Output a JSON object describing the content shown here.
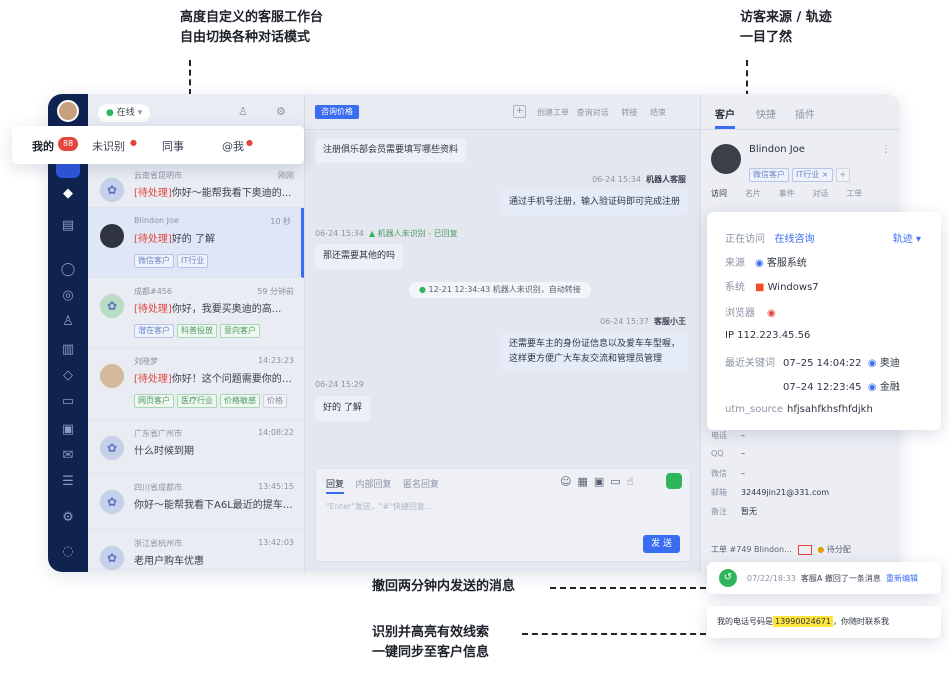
{
  "annotations": {
    "top_left": [
      "高度自定义的客服工作台",
      "自由切换各种对话模式"
    ],
    "top_right": [
      "访客来源 / 轨迹",
      "一目了然"
    ],
    "recall": "撤回两分钟内发送的消息",
    "highlight": [
      "识别并高亮有效线索",
      "一键同步至客户信息"
    ]
  },
  "header": {
    "status": "在线",
    "consult_tab": "咨询价格",
    "actions": [
      "创建工单",
      "查询对话",
      "转接",
      "结束"
    ],
    "right_tabs": [
      "客户",
      "快捷",
      "插件"
    ]
  },
  "list_tabs": {
    "mine": "我的",
    "mine_count": "88",
    "unknown": "未识别",
    "peer": "同事",
    "at": "@我"
  },
  "conversations": [
    {
      "loc": "云南省昆明市",
      "time": "刚刚",
      "status": "[待处理]",
      "msg": "你好～能帮我看下奥迪的...",
      "tags": []
    },
    {
      "name": "Blindon Joe",
      "time": "10 秒",
      "status": "[待处理]",
      "msg": "好的 了解",
      "tags": [
        "微信客户",
        "IT行业"
      ]
    },
    {
      "loc": "成都#456",
      "time": "59 分钟前",
      "status": "[待处理]",
      "msg": "你好，我要买奥迪的高...",
      "tags": [
        "潜在客户",
        "科普投放",
        "意向客户"
      ]
    },
    {
      "name": "刘晓梦",
      "time": "14:23:23",
      "status": "[待处理]",
      "msg": "你好！这个问题需要你的帮...",
      "tags": [
        "网页客户",
        "医疗行业",
        "价格敏感",
        "价格"
      ]
    },
    {
      "loc": "广东省广州市",
      "time": "14:08:22",
      "msg": "什么时候到期",
      "tags": []
    },
    {
      "loc": "四川省成都市",
      "time": "13:45:15",
      "msg": "你好～能帮我看下A6L最近的提车日吗",
      "tags": []
    },
    {
      "loc": "浙江省杭州市",
      "time": "13:42:03",
      "msg": "老用户购车优惠",
      "tags": []
    }
  ],
  "chat": {
    "m1": "注册俱乐部会员需要填写哪些资料",
    "m2_meta": "06-24 15:34",
    "m2_sender": "机器人客服",
    "m2": "通过手机号注册，输入验证码即可完成注册",
    "m3_meta": "06-24 15:34",
    "m3_flag": "机器人未识别 - 已回复",
    "m3": "那还需要其他的吗",
    "system": "12-21 12:34:43  机器人未识别，自动转接",
    "m4_meta": "06-24 15:37",
    "m4_sender": "客服小王",
    "m4": [
      "还需要车主的身份证信息以及爱车车型喔，",
      "这样更方便广大车友交流和管理员管理"
    ],
    "m5_meta": "06-24 15:29",
    "m5": "好的 了解",
    "composer_tabs": [
      "回复",
      "内部回复",
      "匿名回复"
    ],
    "composer_placeholder": "\"Enter\"发送，\"#\"快捷回复...",
    "send": "发 送"
  },
  "customer": {
    "name": "Blindon Joe",
    "tags": [
      "微信客户",
      "IT行业 ×"
    ],
    "subtabs": [
      "访问",
      "名片",
      "事件",
      "对话",
      "工单"
    ],
    "fields": [
      {
        "k": "电话",
        "v": "–"
      },
      {
        "k": "QQ",
        "v": "–"
      },
      {
        "k": "微信",
        "v": "–"
      },
      {
        "k": "邮箱",
        "v": "32449jin21@331.com"
      },
      {
        "k": "备注",
        "v": "暂无"
      }
    ],
    "ticket": "工单 #749   Blindon...",
    "ticket_status": "待分配"
  },
  "visit": {
    "label": "正在访问",
    "value": "在线咨询",
    "track": "轨迹",
    "source_k": "来源",
    "source_v": "客服系统",
    "os_k": "系统",
    "os_v": "Windows7",
    "browser_k": "浏览器",
    "ip": "IP   112.223.45.56",
    "kw_k": "最近关键词",
    "kw1_time": "07–25 14:04:22",
    "kw1": "奥迪",
    "kw2_time": "07–24 12:23:45",
    "kw2": "金融",
    "utm_k": "utm_source",
    "utm_v": "hfjsahfkhsfhfdjkh"
  },
  "recall_card": {
    "time": "07/22/18:33",
    "text": "客服A 撤回了一条消息",
    "link": "重新编辑"
  },
  "phone_card": {
    "pre": "我的电话号码是",
    "num": "13990024671",
    "post": "，你随时联系我"
  },
  "colors": {
    "accent": "#3b6df2",
    "rail": "#10224f",
    "alert": "#e2463d",
    "highlight": "#ffe53b"
  }
}
